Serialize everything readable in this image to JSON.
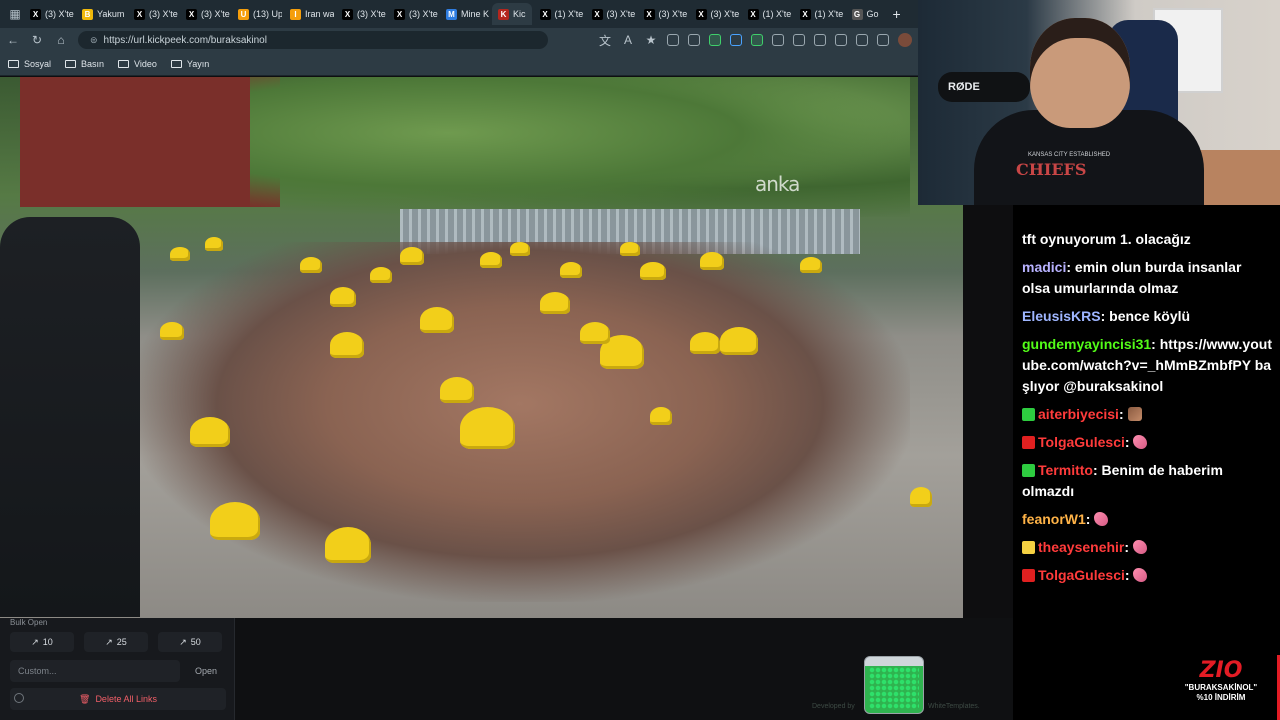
{
  "browser": {
    "tabs": [
      {
        "label": "(3) X'te",
        "icon": "x",
        "color": "#000000"
      },
      {
        "label": "Yakum",
        "icon": "b",
        "color": "#f0b90b"
      },
      {
        "label": "(3) X'te",
        "icon": "x",
        "color": "#000000"
      },
      {
        "label": "(3) X'te",
        "icon": "x",
        "color": "#000000"
      },
      {
        "label": "(13) Up",
        "icon": "u",
        "color": "#f59e0b"
      },
      {
        "label": "Iran wa",
        "icon": "i",
        "color": "#f59e0b"
      },
      {
        "label": "(3) X'te",
        "icon": "x",
        "color": "#000000"
      },
      {
        "label": "(3) X'te",
        "icon": "x",
        "color": "#000000"
      },
      {
        "label": "Mine K",
        "icon": "m",
        "color": "#2f7de1"
      },
      {
        "label": "Kic",
        "icon": "k",
        "color": "#b3261e",
        "active": true
      },
      {
        "label": "(1) X'te",
        "icon": "x",
        "color": "#000000"
      },
      {
        "label": "(3) X'te",
        "icon": "x",
        "color": "#000000"
      },
      {
        "label": "(3) X'te",
        "icon": "x",
        "color": "#000000"
      },
      {
        "label": "(3) X'te",
        "icon": "x",
        "color": "#000000"
      },
      {
        "label": "(1) X'te",
        "icon": "x",
        "color": "#000000"
      },
      {
        "label": "(1) X'te",
        "icon": "x",
        "color": "#000000"
      },
      {
        "label": "Go",
        "icon": "g",
        "color": "#555555"
      }
    ],
    "url": "https://url.kickpeek.com/buraksakinol",
    "bookmarks": [
      "Sosyal",
      "Basın",
      "Video",
      "Yayın"
    ]
  },
  "video": {
    "watermark": "anka"
  },
  "bulk_open": {
    "title": "Bulk Open",
    "buttons": [
      "10",
      "25",
      "50"
    ],
    "custom_placeholder": "Custom...",
    "open_label": "Open",
    "delete_label": "Delete All Links"
  },
  "footer": {
    "dev_left": "Developed by",
    "dev_right": "WhiteTemplates."
  },
  "webcam": {
    "mic_label": "RØDE",
    "shirt_small": "KANSAS CITY ESTABLISHED",
    "shirt_text": "CHIEFS"
  },
  "chat": [
    {
      "user": "",
      "user_color": "#ffffff",
      "text": "tft oynuyorum 1. olacağız",
      "badge": null,
      "emote": null
    },
    {
      "user": "madici",
      "user_color": "#b8b2ff",
      "text": "emin olun burda insanlar olsa umurlarında olmaz",
      "badge": null,
      "emote": null
    },
    {
      "user": "EleusisKRS",
      "user_color": "#9fb6ff",
      "text": "bence köylü",
      "badge": null,
      "emote": null
    },
    {
      "user": "gundemyayincisi31",
      "user_color": "#53fc18",
      "text": "https://www.youtube.com/watch?v=_hMmBZmbfPY başlıyor @buraksakinol",
      "badge": null,
      "emote": null
    },
    {
      "user": "aiterbiyecisi",
      "user_color": "#ff3b3b",
      "text": "",
      "badge": "#2ecc40",
      "emote": "photo"
    },
    {
      "user": "TolgaGulesci",
      "user_color": "#ff3b3b",
      "text": "",
      "badge": "#e02020",
      "emote": "pink"
    },
    {
      "user": "Termitto",
      "user_color": "#ff3b3b",
      "text": "Benim de haberim olmazdı",
      "badge": "#2ecc40",
      "emote": null
    },
    {
      "user": "feanorW1",
      "user_color": "#ffb347",
      "text": "",
      "badge": null,
      "emote": "pink"
    },
    {
      "user": "theaysenehir",
      "user_color": "#ff3b3b",
      "text": "",
      "badge": "#f5d142",
      "emote": "pink"
    },
    {
      "user": "TolgaGulesci",
      "user_color": "#ff3b3b",
      "text": "",
      "badge": "#e02020",
      "emote": "pink"
    }
  ],
  "sponsor": {
    "logo": "ZIO",
    "line1": "\"BURAKSAKİNOL\"",
    "line2": "%10 İNDİRİM"
  }
}
